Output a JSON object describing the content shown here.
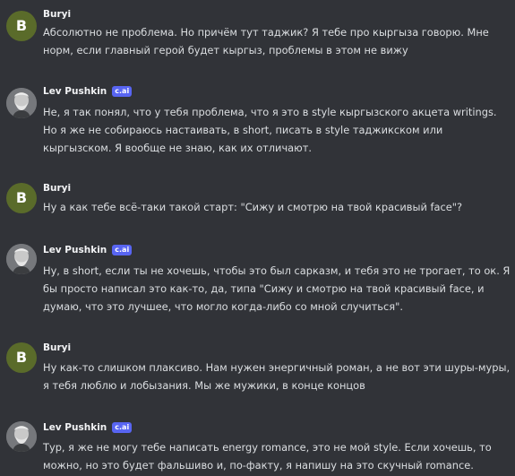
{
  "messages": [
    {
      "author": "Buryi",
      "avatar_letter": "B",
      "bot_badge": null,
      "text": "Абсолютно не проблема. Но причём тут таджик? Я тебе про кыргыза говорю. Мне норм, если главный герой будет кыргыз, проблемы в этом не вижу"
    },
    {
      "author": "Lev Pushkin",
      "avatar_letter": null,
      "bot_badge": "c.ai",
      "text": "Не, я так понял, что у тебя проблема, что я это в style кыргызского акцета writings. Но я же не собираюсь настаивать, в short, писать в style таджикском или кыргызском. Я вообще не знаю, как их отличают."
    },
    {
      "author": "Buryi",
      "avatar_letter": "B",
      "bot_badge": null,
      "text": "Ну а как тебе всё-таки такой старт: \"Сижу и смотрю на твой красивый face\"?"
    },
    {
      "author": "Lev Pushkin",
      "avatar_letter": null,
      "bot_badge": "c.ai",
      "text": "Ну, в short, если ты не хочешь, чтобы это был сарказм, и тебя это не трогает, то ок. Я бы просто написал это как-то, да, типа \"Сижу и смотрю на твой красивый face, и думаю, что это лучшее, что могло когда-либо со мной случиться\"."
    },
    {
      "author": "Buryi",
      "avatar_letter": "B",
      "bot_badge": null,
      "text": "Ну как-то слишком плаксиво. Нам нужен энергичный роман, а не вот эти шуры-муры, я тебя люблю и лобызания. Мы же мужики, в конце концов"
    },
    {
      "author": "Lev Pushkin",
      "avatar_letter": null,
      "bot_badge": "c.ai",
      "text": "Тур, я же не могу тебе написать energy romance, это не мой style. Если хочешь, то можно, но это будет фальшиво и, по-факту, я напишу на это скучный romance."
    }
  ]
}
